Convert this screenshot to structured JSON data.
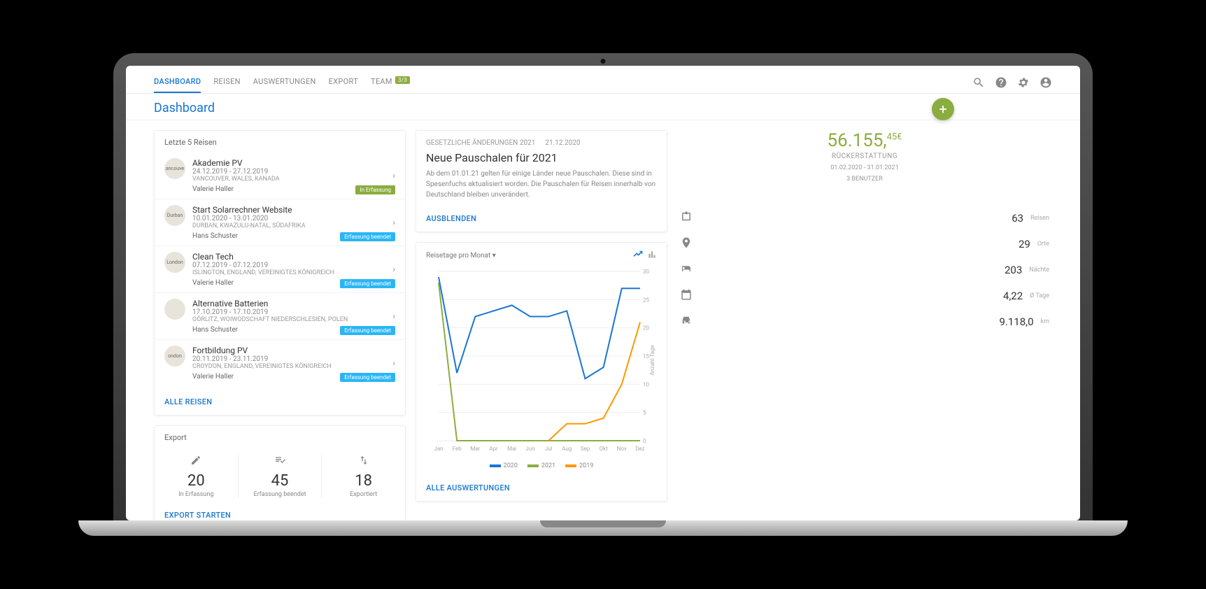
{
  "nav": {
    "tabs": [
      "DASHBOARD",
      "REISEN",
      "AUSWERTUNGEN",
      "EXPORT",
      "TEAM"
    ],
    "team_badge": "3/3"
  },
  "page_title": "Dashboard",
  "trips_card": {
    "title": "Letzte 5 Reisen",
    "all_link": "ALLE REISEN",
    "items": [
      {
        "title": "Akademie PV",
        "dates": "24.12.2019 - 27.12.2019",
        "loc": "VANCOUVER, WALES, KANADA",
        "user": "Valerie Haller",
        "badge": "In Erfassung",
        "badge_class": "badge-green",
        "avatar": "ancouve"
      },
      {
        "title": "Start Solarrechner Website",
        "dates": "10.01.2020 - 13.01.2020",
        "loc": "DURBAN, KWAZULU-NATAL, SÜDAFRIKA",
        "user": "Hans Schuster",
        "badge": "Erfassung beendet",
        "badge_class": "badge-blue",
        "avatar": "Durban"
      },
      {
        "title": "Clean Tech",
        "dates": "07.12.2019 - 07.12.2019",
        "loc": "ISLINGTON, ENGLAND, VEREINIGTES KÖNIGREICH",
        "user": "Valerie Haller",
        "badge": "Erfassung beendet",
        "badge_class": "badge-blue",
        "avatar": "London"
      },
      {
        "title": "Alternative Batterien",
        "dates": "17.10.2019 - 17.10.2019",
        "loc": "GÖRLITZ, WOIWODSCHAFT NIEDERSCHLESIEN, POLEN",
        "user": "Hans Schuster",
        "badge": "Erfassung beendet",
        "badge_class": "badge-blue",
        "avatar": ""
      },
      {
        "title": "Fortbildung PV",
        "dates": "20.11.2019 - 23.11.2019",
        "loc": "CROYDON, ENGLAND, VEREINIGTES KÖNIGREICH",
        "user": "Valerie Haller",
        "badge": "Erfassung beendet",
        "badge_class": "badge-blue",
        "avatar": "ondon"
      }
    ]
  },
  "export_card": {
    "title": "Export",
    "link": "EXPORT STARTEN",
    "items": [
      {
        "count": "20",
        "label": "In Erfassung"
      },
      {
        "count": "45",
        "label": "Erfassung beendet"
      },
      {
        "count": "18",
        "label": "Exportiert"
      }
    ]
  },
  "news": {
    "category": "GESETZLICHE ÄNDERUNGEN 2021",
    "date": "21.12.2020",
    "title": "Neue Pauschalen für 2021",
    "body": "Ab dem 01.01.21 gelten für einige Länder neue Pauschalen. Diese sind in Spesenfuchs aktualisiert worden. Die Pauschalen für Reisen innerhalb von Deutschland bleiben unverändert.",
    "hide": "AUSBLENDEN"
  },
  "chart": {
    "title": "Reisetage pro Monat",
    "ylabel": "Anzahl Tage",
    "all_link": "ALLE AUSWERTUNGEN",
    "legend": [
      "2020",
      "2021",
      "2019"
    ]
  },
  "chart_data": {
    "type": "line",
    "categories": [
      "Jan",
      "Feb",
      "Mar",
      "Apr",
      "Mai",
      "Jun",
      "Jul",
      "Aug",
      "Sep",
      "Okt",
      "Nov",
      "Dez"
    ],
    "series": [
      {
        "name": "2020",
        "color": "#1976d2",
        "values": [
          29,
          12,
          22,
          23,
          24,
          22,
          22,
          23,
          11,
          13,
          27,
          27
        ]
      },
      {
        "name": "2021",
        "color": "#8bad3f",
        "values": [
          28,
          0,
          0,
          0,
          0,
          0,
          0,
          0,
          0,
          0,
          0,
          0
        ]
      },
      {
        "name": "2019",
        "color": "#ff9800",
        "values": [
          null,
          null,
          null,
          null,
          null,
          null,
          0,
          3,
          3,
          4,
          10,
          21
        ]
      }
    ],
    "ylim": [
      0,
      30
    ],
    "xlabel": "",
    "ylabel": "Anzahl Tage"
  },
  "summary": {
    "amount_int": "56.155,",
    "amount_dec": "45€",
    "label": "RÜCKERSTATTUNG",
    "period": "01.02.2020 - 31.01.2021",
    "users": "3 BENUTZER"
  },
  "stats": [
    {
      "value": "63",
      "unit": "Reisen",
      "icon": "briefcase"
    },
    {
      "value": "29",
      "unit": "Orte",
      "icon": "pin"
    },
    {
      "value": "203",
      "unit": "Nächte",
      "icon": "bed"
    },
    {
      "value": "4,22",
      "unit": "Ø Tage",
      "icon": "calendar"
    },
    {
      "value": "9.118,0",
      "unit": "km",
      "icon": "car"
    }
  ]
}
